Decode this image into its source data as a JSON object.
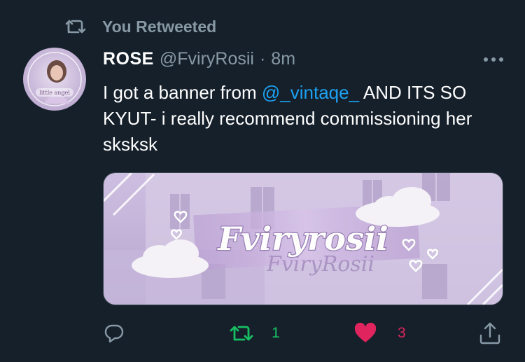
{
  "retweet_context": {
    "label": "You Retweeted",
    "icon": "retweet-icon"
  },
  "author": {
    "display_name": "ROSE",
    "handle": "@FviryRosii",
    "separator": "·",
    "time": "8m",
    "avatar_text": "little angel"
  },
  "tweet": {
    "text_before": "I got a banner from ",
    "mention": "@_vintaqe_",
    "text_after": " AND ITS SO KYUT- i really recommend commissioning her sksksk"
  },
  "media": {
    "banner_title": "Fviryrosii",
    "banner_subtitle": "FviryRosii",
    "description_colors": {
      "sky": "#cbbfe0",
      "building": "#d7cce6",
      "ribbon": "#c3a9d8"
    }
  },
  "actions": {
    "reply_icon": "reply-icon",
    "retweet_icon": "retweet-icon",
    "retweet_count": "1",
    "like_icon": "heart-icon",
    "like_count": "3",
    "share_icon": "share-icon"
  },
  "colors": {
    "background": "#15202b",
    "secondary_text": "#8899a6",
    "link": "#1da1f2",
    "retweet_green": "#17bf63",
    "like_pink": "#e0245e"
  }
}
